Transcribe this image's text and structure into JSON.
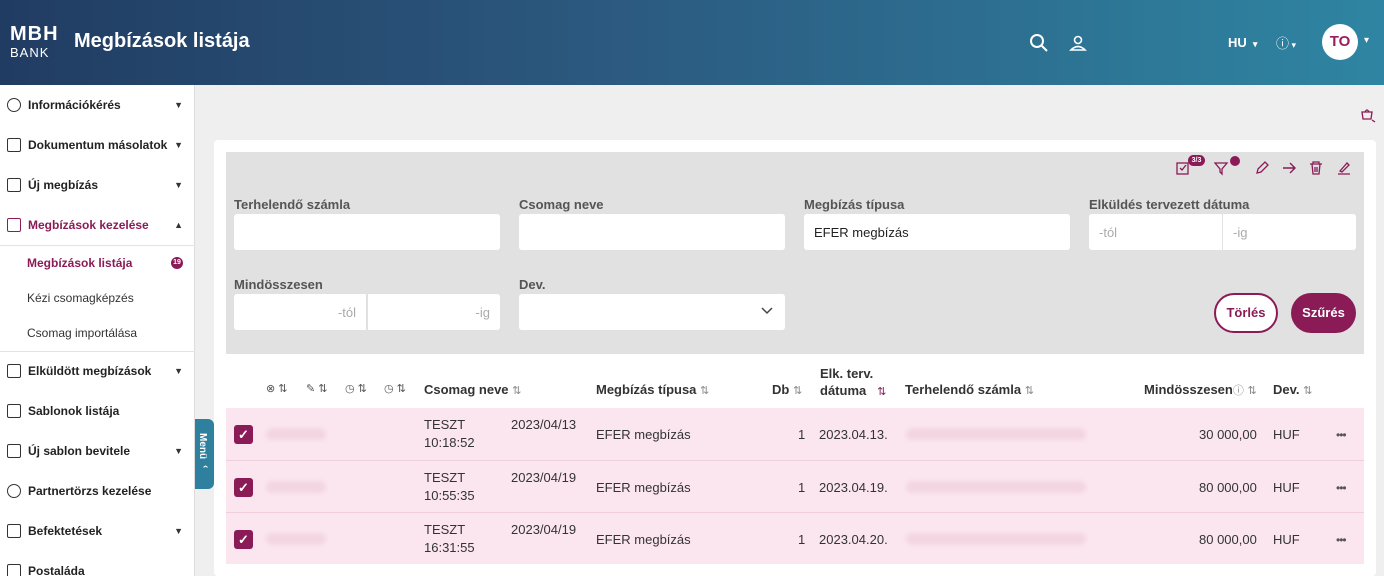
{
  "header": {
    "logo_line1": "MBH",
    "logo_line2": "BANK",
    "title": "Megbízások listája",
    "language": "HU",
    "avatar_initials": "TO"
  },
  "sidebar": {
    "items": [
      {
        "label": "Információkérés",
        "icon": "info-icon"
      },
      {
        "label": "Dokumentum másolatok",
        "icon": "document-icon"
      },
      {
        "label": "Új megbízás",
        "icon": "money-transfer-icon"
      },
      {
        "label": "Megbízások kezelése",
        "icon": "manage-orders-icon"
      },
      {
        "label": "Elküldött megbízások",
        "icon": "sent-orders-icon"
      },
      {
        "label": "Sablonok listája",
        "icon": "template-list-icon"
      },
      {
        "label": "Új sablon bevitele",
        "icon": "new-template-icon"
      },
      {
        "label": "Partnertörzs kezelése",
        "icon": "partners-icon"
      },
      {
        "label": "Befektetések",
        "icon": "investments-icon"
      },
      {
        "label": "Postaláda",
        "icon": "mailbox-icon"
      }
    ],
    "subitems": [
      {
        "label": "Megbízások listája",
        "badge": "19"
      },
      {
        "label": "Kézi csomagképzés"
      },
      {
        "label": "Csomag importálása"
      }
    ],
    "menu_tab": "Menü"
  },
  "filters": {
    "toolbar_badge": "3/3",
    "debit_account_label": "Terhelendő számla",
    "debit_account_value": "",
    "package_name_label": "Csomag neve",
    "package_name_value": "",
    "order_type_label": "Megbízás típusa",
    "order_type_value": "EFER megbízás",
    "send_date_label": "Elküldés tervezett dátuma",
    "send_date_from_placeholder": "-tól",
    "send_date_to_placeholder": "-ig",
    "total_label": "Mindösszesen",
    "total_from_placeholder": "-tól",
    "total_to_placeholder": "-ig",
    "currency_label": "Dev.",
    "currency_value": "",
    "clear_button": "Törlés",
    "filter_button": "Szűrés"
  },
  "table": {
    "headers": {
      "package_name": "Csomag neve",
      "order_type": "Megbízás típusa",
      "count": "Db",
      "planned_date_line1": "Elk. terv.",
      "planned_date_line2": "dátuma",
      "debit_account": "Terhelendő számla",
      "total": "Mindösszesen",
      "currency": "Dev."
    },
    "rows": [
      {
        "name": "TESZT",
        "date": "2023/04/13",
        "time": "10:18:52",
        "type": "EFER megbízás",
        "count": "1",
        "planned": "2023.04.13.",
        "total": "30 000,00",
        "currency": "HUF"
      },
      {
        "name": "TESZT",
        "date": "2023/04/19",
        "time": "10:55:35",
        "type": "EFER megbízás",
        "count": "1",
        "planned": "2023.04.19.",
        "total": "80 000,00",
        "currency": "HUF"
      },
      {
        "name": "TESZT",
        "date": "2023/04/19",
        "time": "16:31:55",
        "type": "EFER megbízás",
        "count": "1",
        "planned": "2023.04.20.",
        "total": "80 000,00",
        "currency": "HUF"
      }
    ]
  },
  "colors": {
    "accent": "#8a1b56",
    "header_start": "#213c62",
    "header_end": "#2e85a2",
    "row_selected": "#fbe6ef"
  }
}
